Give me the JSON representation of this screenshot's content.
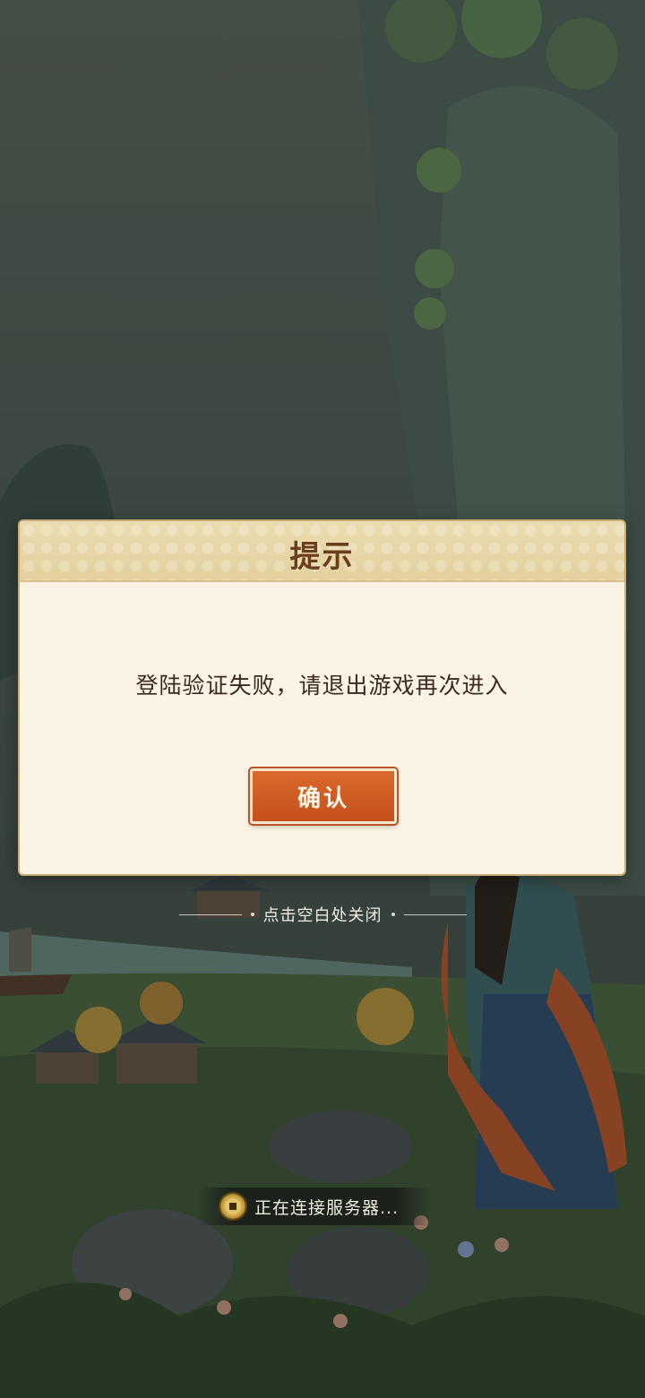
{
  "dialog": {
    "title": "提示",
    "message": "登陆验证失败，请退出游戏再次进入",
    "confirm_label": "确认"
  },
  "dismiss_hint": "点击空白处关闭",
  "status": {
    "text": "正在连接服务器..."
  },
  "colors": {
    "button": "#c9581f",
    "dialog_bg": "#fbf4e4",
    "title": "#6b3f1e"
  }
}
